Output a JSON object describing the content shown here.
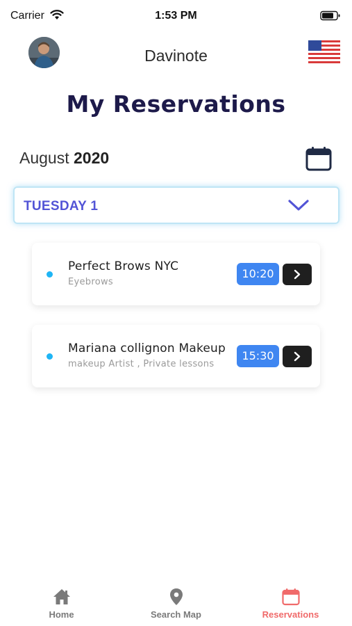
{
  "status_bar": {
    "carrier": "Carrier",
    "time": "1:53 PM",
    "icons": [
      "wifi-icon",
      "battery-icon"
    ]
  },
  "header": {
    "app_name": "Davinote",
    "avatar": "avatar",
    "language_flag": "us-flag-icon"
  },
  "page": {
    "title": "My Reservations"
  },
  "month": {
    "name": "August",
    "year": "2020",
    "icon": "calendar-icon"
  },
  "day_selector": {
    "selected": "TUESDAY 1",
    "icon": "chevron-down-icon"
  },
  "reservations": [
    {
      "name": "Perfect Brows NYC",
      "category": "Eyebrows",
      "time": "10:20",
      "action_icon": "chevron-right-icon"
    },
    {
      "name": "Mariana collignon Makeup",
      "category": "makeup Artist , Private lessons",
      "time": "15:30",
      "action_icon": "chevron-right-icon"
    }
  ],
  "tab_bar": {
    "tabs": [
      {
        "label": "Home",
        "icon": "home-icon",
        "active": false
      },
      {
        "label": "Search Map",
        "icon": "map-pin-icon",
        "active": false
      },
      {
        "label": "Reservations",
        "icon": "calendar-icon",
        "active": true
      }
    ]
  },
  "colors": {
    "title": "#1d1a4a",
    "day_label": "#5254d6",
    "time_badge": "#3f86f1",
    "status_dot": "#1fb5f5",
    "active_tab": "#f06a6a",
    "inactive_tab": "#7a7a7a"
  }
}
